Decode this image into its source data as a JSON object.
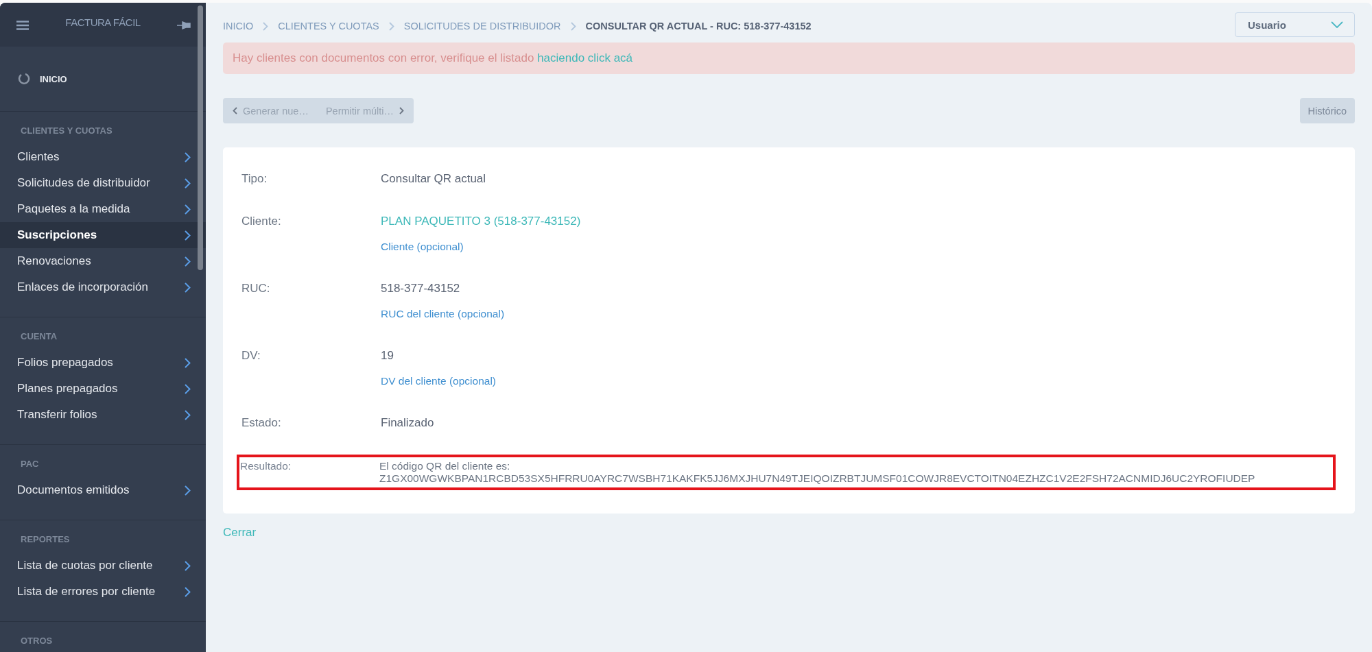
{
  "sidebar": {
    "brand": "FACTURA FÁCIL",
    "home": "INICIO",
    "sections": [
      {
        "title": "CLIENTES Y CUOTAS",
        "items": [
          {
            "label": "Clientes",
            "selected": false
          },
          {
            "label": "Solicitudes de distribuidor",
            "selected": false
          },
          {
            "label": "Paquetes a la medida",
            "selected": false
          },
          {
            "label": "Suscripciones",
            "selected": true
          },
          {
            "label": "Renovaciones",
            "selected": false
          },
          {
            "label": "Enlaces de incorporación",
            "selected": false
          }
        ]
      },
      {
        "title": "CUENTA",
        "items": [
          {
            "label": "Folios prepagados",
            "selected": false
          },
          {
            "label": "Planes prepagados",
            "selected": false
          },
          {
            "label": "Transferir folios",
            "selected": false
          }
        ]
      },
      {
        "title": "PAC",
        "items": [
          {
            "label": "Documentos emitidos",
            "selected": false
          }
        ]
      },
      {
        "title": "REPORTES",
        "items": [
          {
            "label": "Lista de cuotas por cliente",
            "selected": false
          },
          {
            "label": "Lista de errores por cliente",
            "selected": false
          }
        ]
      },
      {
        "title": "OTROS"
      }
    ]
  },
  "breadcrumb": [
    "INICIO",
    "CLIENTES Y CUOTAS",
    "SOLICITUDES DE DISTRIBUIDOR",
    "CONSULTAR QR ACTUAL - RUC: 518-377-43152"
  ],
  "user_menu": {
    "label": "Usuario"
  },
  "alert": {
    "text": "Hay clientes con documentos con error, verifique el listado",
    "link": "haciendo click acá"
  },
  "pager": {
    "previous": "Generar nue…",
    "next": "Permitir múlti…"
  },
  "history_button": "Histórico",
  "fields": [
    {
      "label": "Tipo:",
      "value": "Consultar QR actual",
      "kind": "text"
    },
    {
      "label": "Cliente:",
      "value": "PLAN PAQUETITO 3 (518-377-43152)",
      "kind": "link",
      "hint": "Cliente (opcional)"
    },
    {
      "label": "RUC:",
      "value": "518-377-43152",
      "kind": "text",
      "hint": "RUC del cliente (opcional)"
    },
    {
      "label": "DV:",
      "value": "19",
      "kind": "text",
      "hint": "DV del cliente (opcional)"
    },
    {
      "label": "Estado:",
      "value": "Finalizado",
      "kind": "text"
    }
  ],
  "result": {
    "label": "Resultado:",
    "highlighted": true,
    "lines": [
      "El código QR del cliente es:",
      "Z1GX00WGWKBPAN1RCBD53SX5HFRRU0AYRC7WSBH71KAKFK5JJ6MXJHU7N49TJEIQOIZRBTJUMSF01COWJR8EVCTOITN04EZHZC1V2E2FSH72ACNMIDJ6UC2YROFIUDEP"
    ]
  },
  "close_link": "Cerrar"
}
